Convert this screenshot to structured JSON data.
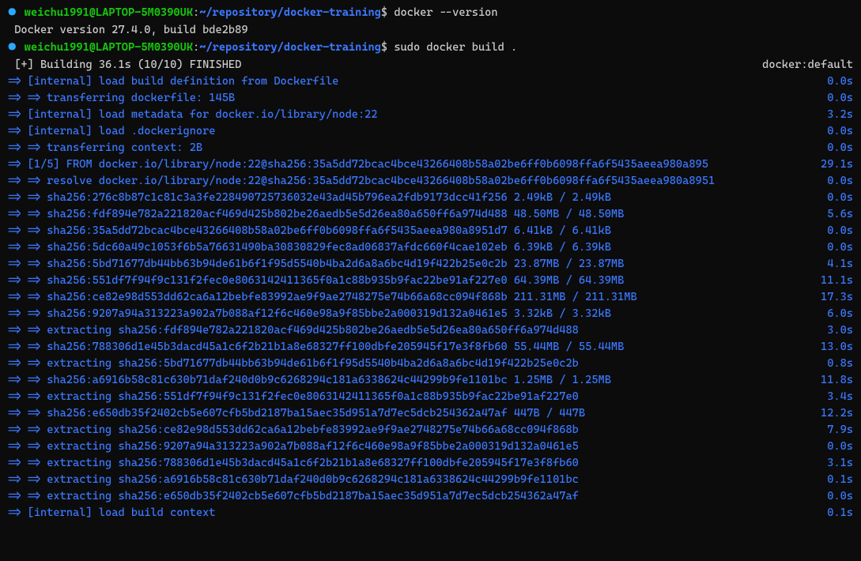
{
  "prompt1": {
    "user": "weichu1991@LAPTOP-5M0390UK",
    "colon": ":",
    "path": "~/repository/docker-training",
    "dollar": "$",
    "command": "docker --version"
  },
  "version_output": "Docker version 27.4.0, build bde2b89",
  "prompt2": {
    "user": "weichu1991@LAPTOP-5M0390UK",
    "colon": ":",
    "path": "~/repository/docker-training",
    "dollar": "$",
    "command": "sudo docker build ."
  },
  "build_header": {
    "left": "[+] Building 36.1s (10/10) FINISHED",
    "right": "docker:default"
  },
  "steps": [
    {
      "arrow": " => ",
      "text": "[internal] load build definition from Dockerfile",
      "dur": "0.0s"
    },
    {
      "arrow": " => => ",
      "text": "transferring dockerfile: 145B",
      "dur": "0.0s"
    },
    {
      "arrow": " => ",
      "text": "[internal] load metadata for docker.io/library/node:22",
      "dur": "3.2s"
    },
    {
      "arrow": " => ",
      "text": "[internal] load .dockerignore",
      "dur": "0.0s"
    },
    {
      "arrow": " => => ",
      "text": "transferring context: 2B",
      "dur": "0.0s"
    },
    {
      "arrow": " => ",
      "text": "[1/5] FROM docker.io/library/node:22@sha256:35a5dd72bcac4bce43266408b58a02be6ff0b6098ffa6f5435aeea980a895",
      "dur": "29.1s"
    },
    {
      "arrow": " => => ",
      "text": "resolve docker.io/library/node:22@sha256:35a5dd72bcac4bce43266408b58a02be6ff0b6098ffa6f5435aeea980a8951",
      "dur": "0.0s"
    },
    {
      "arrow": " => => ",
      "text": "sha256:276c8b87c1c81c3a3fe228490725736032e43ad45b796ea2fdb9173dcc41f256 2.49kB / 2.49kB",
      "dur": "0.0s"
    },
    {
      "arrow": " => => ",
      "text": "sha256:fdf894e782a221820acf469d425b802be26aedb5e5d26ea80a650ff6a974d488 48.50MB / 48.50MB",
      "dur": "5.6s"
    },
    {
      "arrow": " => => ",
      "text": "sha256:35a5dd72bcac4bce43266408b58a02be6ff0b6098ffa6f5435aeea980a8951d7 6.41kB / 6.41kB",
      "dur": "0.0s"
    },
    {
      "arrow": " => => ",
      "text": "sha256:5dc60a49c1053f6b5a76631490ba30830829fec8ad06837afdc660f4cae102eb 6.39kB / 6.39kB",
      "dur": "0.0s"
    },
    {
      "arrow": " => => ",
      "text": "sha256:5bd71677db44bb63b94de61b6f1f95d5540b4ba2d6a8a6bc4d19f422b25e0c2b 23.87MB / 23.87MB",
      "dur": "4.1s"
    },
    {
      "arrow": " => => ",
      "text": "sha256:551df7f94f9c131f2fec0e8063142411365f0a1c88b935b9fac22be91af227e0 64.39MB / 64.39MB",
      "dur": "11.1s"
    },
    {
      "arrow": " => => ",
      "text": "sha256:ce82e98d553dd62ca6a12bebfe83992ae9f9ae2748275e74b66a68cc094f868b 211.31MB / 211.31MB",
      "dur": "17.3s"
    },
    {
      "arrow": " => => ",
      "text": "sha256:9207a94a313223a902a7b088af12f6c460e98a9f85bbe2a000319d132a0461e5 3.32kB / 3.32kB",
      "dur": "6.0s"
    },
    {
      "arrow": " => => ",
      "text": "extracting sha256:fdf894e782a221820acf469d425b802be26aedb5e5d26ea80a650ff6a974d488",
      "dur": "3.0s"
    },
    {
      "arrow": " => => ",
      "text": "sha256:788306d1e45b3dacd45a1c6f2b21b1a8e68327ff100dbfe205945f17e3f8fb60 55.44MB / 55.44MB",
      "dur": "13.0s"
    },
    {
      "arrow": " => => ",
      "text": "extracting sha256:5bd71677db44bb63b94de61b6f1f95d5540b4ba2d6a8a6bc4d19f422b25e0c2b",
      "dur": "0.8s"
    },
    {
      "arrow": " => => ",
      "text": "sha256:a6916b58c81c630b71daf240d0b9c6268294c181a6338624c44299b9fe1101bc 1.25MB / 1.25MB",
      "dur": "11.8s"
    },
    {
      "arrow": " => => ",
      "text": "extracting sha256:551df7f94f9c131f2fec0e8063142411365f0a1c88b935b9fac22be91af227e0",
      "dur": "3.4s"
    },
    {
      "arrow": " => => ",
      "text": "sha256:e650db35f2402cb5e607cfb5bd2187ba15aec35d951a7d7ec5dcb254362a47af 447B / 447B",
      "dur": "12.2s"
    },
    {
      "arrow": " => => ",
      "text": "extracting sha256:ce82e98d553dd62ca6a12bebfe83992ae9f9ae2748275e74b66a68cc094f868b",
      "dur": "7.9s"
    },
    {
      "arrow": " => => ",
      "text": "extracting sha256:9207a94a313223a902a7b088af12f6c460e98a9f85bbe2a000319d132a0461e5",
      "dur": "0.0s"
    },
    {
      "arrow": " => => ",
      "text": "extracting sha256:788306d1e45b3dacd45a1c6f2b21b1a8e68327ff100dbfe205945f17e3f8fb60",
      "dur": "3.1s"
    },
    {
      "arrow": " => => ",
      "text": "extracting sha256:a6916b58c81c630b71daf240d0b9c6268294c181a6338624c44299b9fe1101bc",
      "dur": "0.1s"
    },
    {
      "arrow": " => => ",
      "text": "extracting sha256:e650db35f2402cb5e607cfb5bd2187ba15aec35d951a7d7ec5dcb254362a47af",
      "dur": "0.0s"
    },
    {
      "arrow": " => ",
      "text": "[internal] load build context",
      "dur": "0.1s"
    }
  ]
}
